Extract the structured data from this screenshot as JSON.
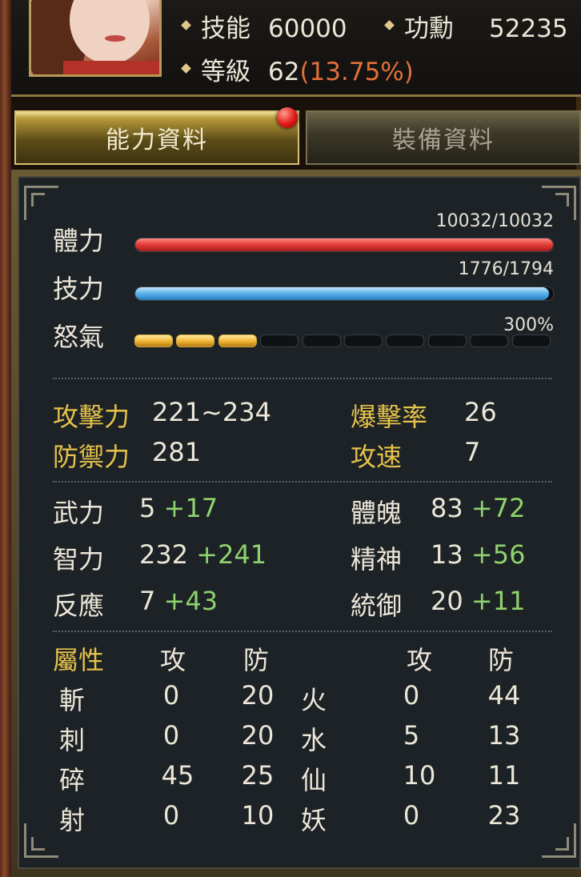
{
  "header": {
    "skill_label": "技能",
    "skill_value": "60000",
    "merit_label": "功勳",
    "merit_value": "52235",
    "level_label": "等級",
    "level_value": "62",
    "level_pct": "(13.75%)"
  },
  "tabs": {
    "ability": "能力資料",
    "equipment": "裝備資料"
  },
  "bars": {
    "hp": {
      "label": "體力",
      "text": "10032/10032",
      "current": 10032,
      "max": 10032
    },
    "mp": {
      "label": "技力",
      "text": "1776/1794",
      "current": 1776,
      "max": 1794
    },
    "rage": {
      "label": "怒氣",
      "text": "300%",
      "filled": 3,
      "segments": 10
    }
  },
  "combat": {
    "attack_label": "攻擊力",
    "attack_value": "221~234",
    "defense_label": "防禦力",
    "defense_value": "281",
    "crit_label": "爆擊率",
    "crit_value": "26",
    "speed_label": "攻速",
    "speed_value": "7"
  },
  "attributes": [
    {
      "label": "武力",
      "base": "5",
      "bonus": "+17"
    },
    {
      "label": "智力",
      "base": "232",
      "bonus": "+241"
    },
    {
      "label": "反應",
      "base": "7",
      "bonus": "+43"
    },
    {
      "label": "體魄",
      "base": "83",
      "bonus": "+72"
    },
    {
      "label": "精神",
      "base": "13",
      "bonus": "+56"
    },
    {
      "label": "統御",
      "base": "20",
      "bonus": "+11"
    }
  ],
  "elements": {
    "header_title": "屬性",
    "atk_header": "攻",
    "def_header": "防",
    "left": [
      {
        "name": "斬",
        "atk": "0",
        "def": "20"
      },
      {
        "name": "刺",
        "atk": "0",
        "def": "20"
      },
      {
        "name": "碎",
        "atk": "45",
        "def": "25"
      },
      {
        "name": "射",
        "atk": "0",
        "def": "10"
      }
    ],
    "right": [
      {
        "name": "火",
        "atk": "0",
        "def": "44"
      },
      {
        "name": "水",
        "atk": "5",
        "def": "13"
      },
      {
        "name": "仙",
        "atk": "10",
        "def": "11"
      },
      {
        "name": "妖",
        "atk": "0",
        "def": "23"
      }
    ]
  },
  "colors": {
    "gold": "#e6c24a",
    "bonus_green": "#8fd26e",
    "level_pct": "#e2703a",
    "hp": "#e03a38",
    "mp": "#58b0ea",
    "rage": "#f0b432"
  },
  "icons": {
    "notification": "red-notification-dot",
    "bullet": "diamond-bullet-icon"
  }
}
